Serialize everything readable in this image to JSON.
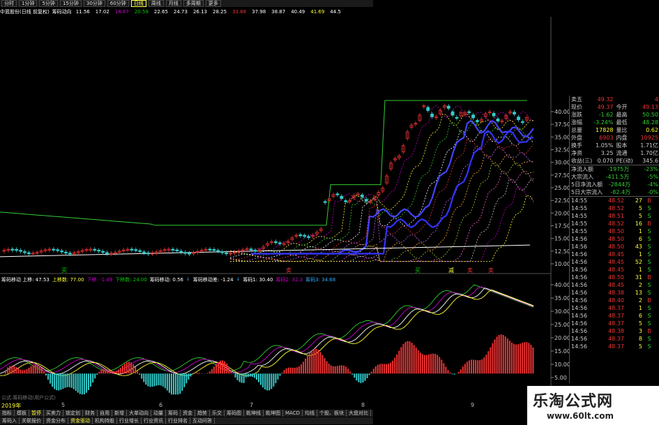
{
  "toolbar": {
    "periods": [
      "分时",
      "1分钟",
      "5分钟",
      "15分钟",
      "30分钟",
      "60分钟",
      "日线",
      "周线",
      "月线",
      "多周期",
      "更多"
    ],
    "active": "日线"
  },
  "title_line": {
    "stock": "中篮股份(日线 前复权)",
    "indicator": "筹码动向",
    "values": [
      "11.56",
      "17.02",
      "18.67",
      "20.59",
      "22.65",
      "24.73",
      "26.13",
      "28.25",
      "33.68",
      "37.98",
      "38.87",
      "40.49",
      "41.69",
      "44.5"
    ],
    "colors": [
      "#fff",
      "#fff",
      "#c0c",
      "#0c0",
      "#fff",
      "#fff",
      "#fff",
      "#fff",
      "#e33",
      "#fff",
      "#fff",
      "#fff",
      "#ff3",
      "#fff"
    ]
  },
  "price_axis": [
    "40.00",
    "37.50",
    "35.00",
    "32.50",
    "30.00",
    "27.50",
    "25.00",
    "22.50",
    "20.00",
    "17.50",
    "15.00",
    "12.50",
    "10.00"
  ],
  "ind_axis": [
    "40.00",
    "35.00",
    "30.00",
    "25.00",
    "20.00",
    "15.00",
    "10.00",
    "5.00"
  ],
  "markers": [
    {
      "t": "买",
      "c": "#0c0"
    },
    {
      "t": "卖",
      "c": "#e33"
    },
    {
      "t": "买",
      "c": "#0c0"
    },
    {
      "t": "减",
      "c": "#ff3"
    },
    {
      "t": "卖",
      "c": "#e33"
    },
    {
      "t": "卖",
      "c": "#e33"
    }
  ],
  "indicator_bar": [
    {
      "t": "筹码移动 上移: 47.53",
      "c": "#fff"
    },
    {
      "t": "上移数: 77.00",
      "c": "#ff3"
    },
    {
      "t": "下移: -1.49",
      "c": "#c0c"
    },
    {
      "t": "下移数: 24.00",
      "c": "#0c0"
    },
    {
      "t": "筹码移动: 0.56",
      "c": "#fff"
    },
    {
      "t": "↓",
      "c": "#3af"
    },
    {
      "t": "筹码移动差: -1.24",
      "c": "#fff"
    },
    {
      "t": "↓",
      "c": "#3af"
    },
    {
      "t": "筹码1: 30.40",
      "c": "#fff"
    },
    {
      "t": "筹码2: 32.3",
      "c": "#c0c"
    },
    {
      "t": "筹码3: 34.68",
      "c": "#3af"
    }
  ],
  "quote": {
    "rows": [
      {
        "l": "卖五",
        "v": "49.32",
        "l2": "",
        "v2": "4",
        "vc": "#e33"
      },
      {
        "l": "现价",
        "v": "49.37",
        "l2": "今开",
        "v2": "49.13",
        "vc": "#e33"
      },
      {
        "l": "涨跌",
        "v": "-1.62",
        "l2": "最高",
        "v2": "50.50",
        "vc": "#3c3"
      },
      {
        "l": "涨幅",
        "v": "-3.24%",
        "l2": "最低",
        "v2": "48.28",
        "vc": "#3c3"
      },
      {
        "l": "总量",
        "v": "17828",
        "l2": "量比",
        "v2": "0.62",
        "vc": "#ff3"
      },
      {
        "l": "外盘",
        "v": "6903",
        "l2": "内盘",
        "v2": "10925",
        "vc": "#e33"
      },
      {
        "l": "换手",
        "v": "1.05%",
        "l2": "股本",
        "v2": "1.71亿",
        "vc": "#ccc"
      },
      {
        "l": "净资",
        "v": "3.25",
        "l2": "流通",
        "v2": "1.70亿",
        "vc": "#ccc"
      },
      {
        "l": "收益(三)",
        "v": "0.070",
        "l2": "PE(动)",
        "v2": "345.6",
        "vc": "#ccc"
      }
    ],
    "flows": [
      {
        "l": "净流入额",
        "v": "-1975万",
        "p": "-23%"
      },
      {
        "l": "大宗流入",
        "v": "-411.5万",
        "p": "-5%"
      },
      {
        "l": "5日净流入额",
        "v": "-2844万",
        "p": "-4%"
      },
      {
        "l": "5日大宗流入",
        "v": "-82.4万",
        "p": "-0%"
      }
    ]
  },
  "ticks": [
    {
      "t": "14:55",
      "p": "48.52",
      "n": "27",
      "s": "B"
    },
    {
      "t": "14:55",
      "p": "48.52",
      "n": "5",
      "s": "S"
    },
    {
      "t": "14:55",
      "p": "48.51",
      "n": "5",
      "s": "S"
    },
    {
      "t": "14:55",
      "p": "48.52",
      "n": "16",
      "s": "B"
    },
    {
      "t": "14:55",
      "p": "48.50",
      "n": "1",
      "s": "S"
    },
    {
      "t": "14:56",
      "p": "48.50",
      "n": "6",
      "s": "S"
    },
    {
      "t": "14:56",
      "p": "48.50",
      "n": "43",
      "s": "S"
    },
    {
      "t": "14:56",
      "p": "48.45",
      "n": "1",
      "s": "S"
    },
    {
      "t": "14:56",
      "p": "48.45",
      "n": "52",
      "s": "S"
    },
    {
      "t": "14:56",
      "p": "48.45",
      "n": "1",
      "s": "S"
    },
    {
      "t": "14:56",
      "p": "48.50",
      "n": "31",
      "s": "B"
    },
    {
      "t": "14:56",
      "p": "48.45",
      "n": "2",
      "s": "S"
    },
    {
      "t": "14:56",
      "p": "48.38",
      "n": "13",
      "s": "S"
    },
    {
      "t": "14:56",
      "p": "48.40",
      "n": "2",
      "s": "B"
    },
    {
      "t": "14:56",
      "p": "48.37",
      "n": "1",
      "s": "S"
    },
    {
      "t": "14:56",
      "p": "48.37",
      "n": "6",
      "s": "S"
    },
    {
      "t": "14:56",
      "p": "48.37",
      "n": "5",
      "s": "S"
    },
    {
      "t": "14:56",
      "p": "48.38",
      "n": "3",
      "s": "B"
    },
    {
      "t": "14:56",
      "p": "48.37",
      "n": "8",
      "s": "S"
    },
    {
      "t": "14:56",
      "p": "48.37",
      "n": "5",
      "s": "S"
    }
  ],
  "xaxis": {
    "year": "2019年",
    "months": [
      "5",
      "6",
      "7",
      "8",
      "9"
    ]
  },
  "tabs1": [
    "指标",
    "模板",
    "暂停",
    "买卖力",
    "锁定划",
    "财务",
    "自用",
    "新增",
    "大单动向",
    "动量",
    "筹码",
    "资金",
    "趋势",
    "乐交",
    "筹码图",
    "乾坤线",
    "乾坤图",
    "MACD",
    "均线",
    "个股、板块",
    "大盘对比"
  ],
  "tabs1_active": "暂停",
  "tabs2": [
    "筹码入",
    "关联报价",
    "资金分布",
    "资金驱动",
    "机构持股",
    "行业增长",
    "行业资讯",
    "行业排名",
    "互动问答"
  ],
  "tabs2_active": "资金驱动",
  "formula_label": "公式:筹码移动(用户公式)",
  "brand": {
    "name": "乐淘公式网",
    "url": "www.60lt.com"
  }
}
